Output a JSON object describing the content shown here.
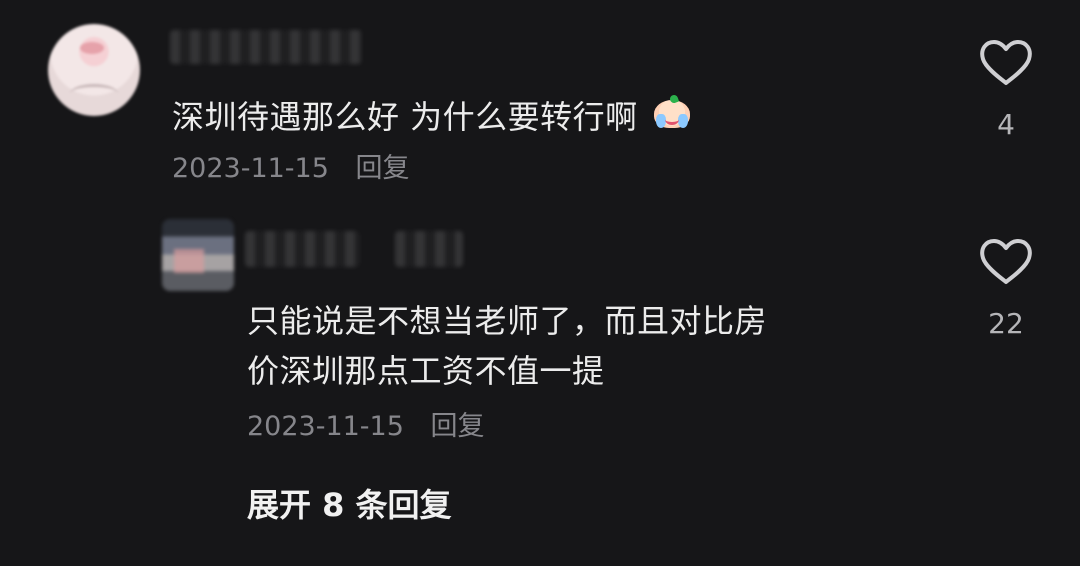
{
  "comment": {
    "text": "深圳待遇那么好 为什么要转行啊",
    "date": "2023-11-15",
    "reply_label": "回复",
    "likes": "4",
    "emoji_icon": "crying-face-emoji-icon",
    "heart_icon": "heart-icon"
  },
  "reply": {
    "text_line_1": "只能说是不想当老师了，而且对比房",
    "text_line_2": "价深圳那点工资不值一提",
    "date": "2023-11-15",
    "reply_label": "回复",
    "likes": "22",
    "heart_icon": "heart-icon"
  },
  "thread": {
    "expand_label": "展开 8 条回复"
  },
  "colors": {
    "background": "#161618",
    "text": "#ececec",
    "meta_text": "#86868b"
  }
}
